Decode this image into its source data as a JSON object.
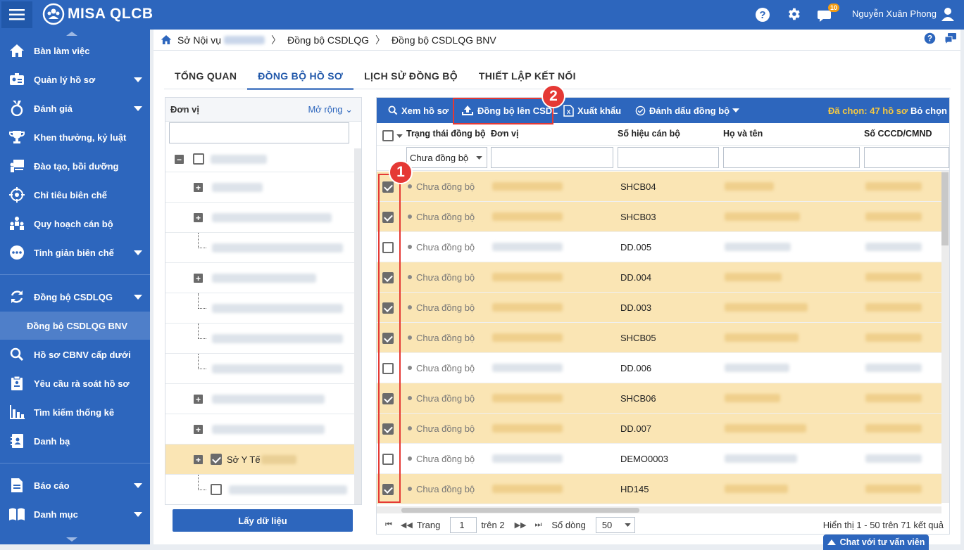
{
  "app": {
    "title": "MISA QLCB",
    "user": "Nguyễn Xuân Phong",
    "notification_count": "10"
  },
  "sidebar": {
    "items": [
      {
        "label": "Bàn làm việc",
        "icon": "home-icon"
      },
      {
        "label": "Quản lý hồ sơ",
        "icon": "profile-card-icon"
      },
      {
        "label": "Đánh giá",
        "icon": "medal-icon"
      },
      {
        "label": "Khen thưởng, kỷ luật",
        "icon": "trophy-icon"
      },
      {
        "label": "Đào tạo, bồi dưỡng",
        "icon": "teacher-board-icon"
      },
      {
        "label": "Chỉ tiêu biên chế",
        "icon": "target-icon"
      },
      {
        "label": "Quy hoạch cán bộ",
        "icon": "people-group-icon"
      },
      {
        "label": "Tinh giản biên chế",
        "icon": "more-icon"
      },
      {
        "label": "Đồng bộ CSDLQG",
        "icon": "sync-icon"
      },
      {
        "label": "Đồng bộ CSDLQG BNV",
        "icon": ""
      },
      {
        "label": "Hồ sơ CBNV cấp dưới",
        "icon": "search-icon"
      },
      {
        "label": "Yêu cầu rà soát hồ sơ",
        "icon": "clipboard-icon"
      },
      {
        "label": "Tìm kiếm thống kê",
        "icon": "bar-chart-icon"
      },
      {
        "label": "Danh bạ",
        "icon": "contacts-icon"
      },
      {
        "label": "Báo cáo",
        "icon": "report-icon"
      },
      {
        "label": "Danh mục",
        "icon": "book-icon"
      }
    ]
  },
  "breadcrumb": {
    "item1": "Sở Nội vụ",
    "item2": "Đồng bộ CSDLQG",
    "item3": "Đồng bộ CSDLQG BNV"
  },
  "tabs": [
    "TỔNG QUAN",
    "ĐỒNG BỘ HỒ SƠ",
    "LỊCH SỬ ĐỒNG BỘ",
    "THIẾT LẬP KẾT NỐI"
  ],
  "active_tab": "ĐỒNG BỘ HỒ SƠ",
  "left_panel": {
    "header": "Đơn vị",
    "expand_label": "Mở rộng",
    "search_value": "",
    "selected_node_label": "Sở Y Tế",
    "get_data_button": "Lấy dữ liệu"
  },
  "toolbar": {
    "view_label": "Xem hồ sơ",
    "sync_label": "Đồng bộ lên CSDL",
    "export_label": "Xuất khẩu",
    "mark_label": "Đánh dấu đồng bộ",
    "selected_text": "Đã chọn: 47 hồ sơ",
    "deselect_label": "Bỏ chọn"
  },
  "grid": {
    "columns": [
      "Trạng thái đồng bộ",
      "Đơn vị",
      "Số hiệu cán bộ",
      "Họ và tên",
      "Số CCCD/CMND"
    ],
    "status_filter": "Chưa đồng bộ",
    "rows": [
      {
        "checked": true,
        "status": "Chưa đồng bộ",
        "code": "SHCB04"
      },
      {
        "checked": true,
        "status": "Chưa đồng bộ",
        "code": "SHCB03"
      },
      {
        "checked": false,
        "status": "Chưa đồng bộ",
        "code": "DD.005"
      },
      {
        "checked": true,
        "status": "Chưa đồng bộ",
        "code": "DD.004"
      },
      {
        "checked": true,
        "status": "Chưa đồng bộ",
        "code": "DD.003"
      },
      {
        "checked": true,
        "status": "Chưa đồng bộ",
        "code": "SHCB05"
      },
      {
        "checked": false,
        "status": "Chưa đồng bộ",
        "code": "DD.006"
      },
      {
        "checked": true,
        "status": "Chưa đồng bộ",
        "code": "SHCB06"
      },
      {
        "checked": true,
        "status": "Chưa đồng bộ",
        "code": "DD.007"
      },
      {
        "checked": false,
        "status": "Chưa đồng bộ",
        "code": "DEMO0003"
      },
      {
        "checked": true,
        "status": "Chưa đồng bộ",
        "code": "HD145"
      }
    ]
  },
  "pager": {
    "page_label": "Trang",
    "page_value": "1",
    "of_label": "trên 2",
    "rows_label": "Số dòng",
    "rows_value": "50",
    "summary": "Hiển thị 1 - 50 trên 71 kết quả"
  },
  "annotations": {
    "marker1": "1",
    "marker2": "2"
  },
  "chat_label": "Chat với tư vấn viên",
  "colors": {
    "primary": "#2d66bd",
    "selected_row": "#fae5b4",
    "highlight": "#e53935"
  }
}
